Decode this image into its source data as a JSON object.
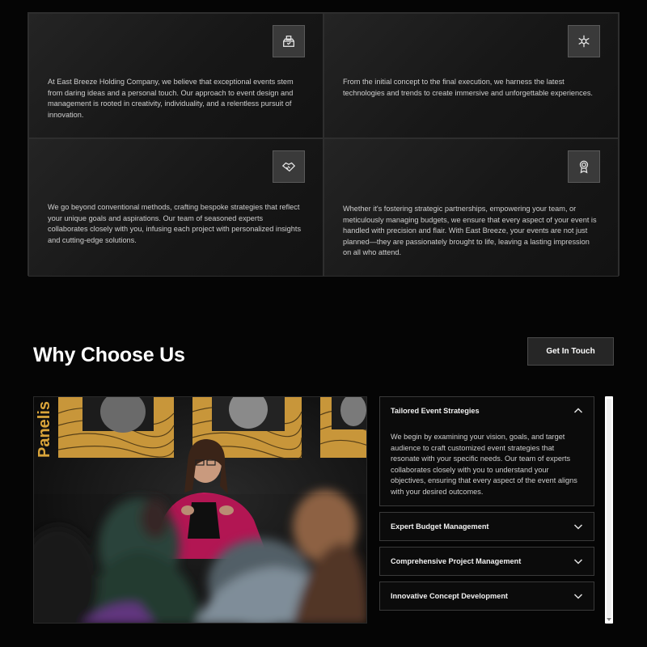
{
  "features": [
    {
      "icon": "voting-box-icon",
      "text": "At East Breeze Holding Company, we believe that exceptional events stem from daring ideas and a personal touch. Our approach to event design and management is rooted in creativity, individuality, and a relentless pursuit of innovation."
    },
    {
      "icon": "snowflake-gear-icon",
      "text": "From the initial concept to the final execution, we harness the latest technologies and trends to create immersive and unforgettable experiences."
    },
    {
      "icon": "handshake-icon",
      "text": "We go beyond conventional methods, crafting bespoke strategies that reflect your unique goals and aspirations. Our team of seasoned experts collaborates closely with you, infusing each project with personalized insights and cutting-edge solutions."
    },
    {
      "icon": "award-ribbon-icon",
      "text": "Whether it's fostering strategic partnerships, empowering your team, or meticulously managing budgets, we ensure that every aspect of your event is handled with precision and flair. With East Breeze, your events are not just planned—they are passionately brought to life, leaving a lasting impression on all who attend."
    }
  ],
  "why": {
    "title": "Why Choose Us",
    "cta_label": "Get In Touch",
    "photo_sign_text": "Panelis"
  },
  "accordion": [
    {
      "title": "Tailored Event Strategies",
      "open": true,
      "body": "We begin by examining your vision, goals, and target audience to craft customized event strategies that resonate with your specific needs. Our team of experts collaborates closely with you to understand your objectives, ensuring that every aspect of the event aligns with your desired outcomes."
    },
    {
      "title": "Expert Budget Management",
      "open": false
    },
    {
      "title": "Comprehensive Project Management",
      "open": false
    },
    {
      "title": "Innovative Concept Development",
      "open": false
    }
  ],
  "colors": {
    "page_bg": "#050505",
    "card_bg": "#1c1c1c",
    "accent_magenta": "#c2185b",
    "accent_gold": "#d9a43a"
  }
}
